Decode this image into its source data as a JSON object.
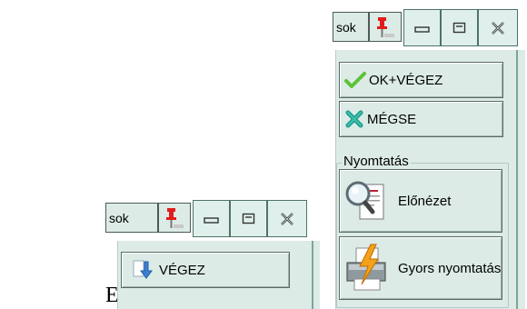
{
  "caption": {
    "text": "Eredeti:"
  },
  "left_window": {
    "tab_label": "sok",
    "vegez_label": "VÉGEZ"
  },
  "right_window": {
    "tab_label": "sok",
    "ok_label": "OK+VÉGEZ",
    "cancel_label": "MÉGSE",
    "print_group_label": "Nyomtatás",
    "preview_label": "Előnézet",
    "quick_print_label": "Gyors nyomtatás"
  },
  "icons": {
    "pin": "pushpin-icon",
    "minimize": "minimize-icon",
    "maximize": "maximize-icon",
    "close": "close-icon",
    "check": "checkmark-icon",
    "x": "cross-icon",
    "magnifier": "magnifier-icon",
    "printer": "printer-icon",
    "download": "download-arrow-icon"
  },
  "colors": {
    "panel_bg": "#dcebe6",
    "check_green": "#5cc23a",
    "cross_teal": "#1f9b8b",
    "pin_red": "#e21b1b",
    "bolt_orange": "#f2a21b"
  }
}
